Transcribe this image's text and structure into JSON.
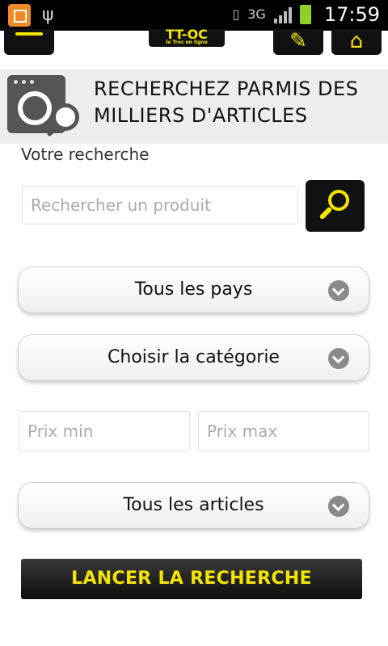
{
  "status_bar": {
    "time": "17:59",
    "network": "3G",
    "icons": [
      "app-notification-icon",
      "usb-icon",
      "vibrate-icon",
      "3g-data-icon",
      "signal-icon",
      "battery-charging-icon"
    ]
  },
  "nav": {
    "logo_text": "TT-OC",
    "logo_subtext": "le Troc en ligne",
    "icons": [
      "menu-icon",
      "pencil-icon",
      "home-icon"
    ],
    "accent_color": "#f2e600"
  },
  "header": {
    "title": "RECHERCHEZ PARMIS DES MILLIERS D'ARTICLES",
    "icon": "camera-search-icon"
  },
  "form": {
    "search_label": "Votre recherche",
    "search_placeholder": "Rechercher un produit",
    "search_value": "",
    "country_select": "Tous les pays",
    "category_select": "Choisir la catégorie",
    "price_min_placeholder": "Prix min",
    "price_max_placeholder": "Prix max",
    "articles_select": "Tous les articles",
    "submit_label": "LANCER LA RECHERCHE"
  }
}
